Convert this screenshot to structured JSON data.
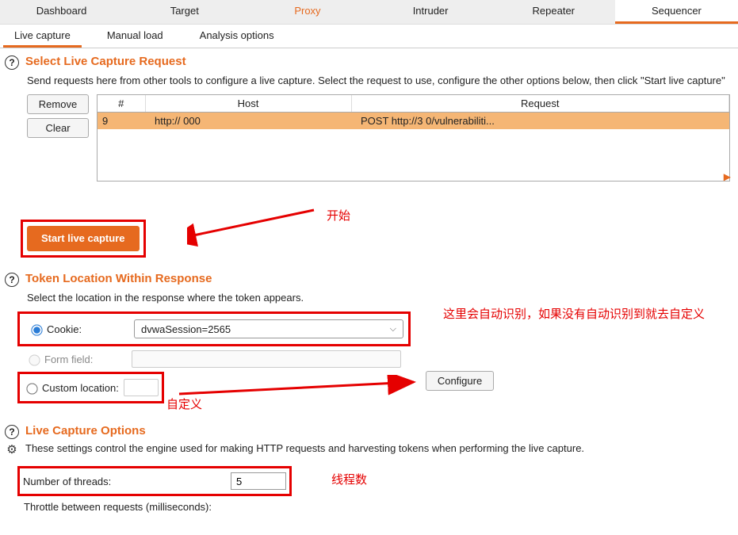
{
  "tool_tabs": {
    "dashboard": "Dashboard",
    "target": "Target",
    "proxy": "Proxy",
    "intruder": "Intruder",
    "repeater": "Repeater",
    "sequencer": "Sequencer"
  },
  "sub_tabs": {
    "live_capture": "Live capture",
    "manual_load": "Manual load",
    "analysis_options": "Analysis options"
  },
  "section1": {
    "title": "Select Live Capture Request",
    "desc": "Send requests here from other tools to configure a live capture. Select the request to use, configure the other options below, then click \"Start live capture\"",
    "remove": "Remove",
    "clear": "Clear",
    "col_num": "#",
    "col_host": "Host",
    "col_req": "Request",
    "row_num": "9",
    "row_host": "http://                          000",
    "row_req": "POST http://3                         0/vulnerabiliti...",
    "start_btn": "Start live capture"
  },
  "anno": {
    "start": "开始",
    "auto_detect": "这里会自动识别，如果没有自动识别到就去自定义",
    "custom": "自定义",
    "threads": "线程数"
  },
  "section2": {
    "title": "Token Location Within Response",
    "desc": "Select the location in the response where the token appears.",
    "cookie_label": "Cookie:",
    "cookie_value": "dvwaSession=2565",
    "form_label": "Form field:",
    "custom_label": "Custom location:",
    "configure": "Configure"
  },
  "section3": {
    "title": "Live Capture Options",
    "desc": "These settings control the engine used for making HTTP requests and harvesting tokens when performing the live capture.",
    "threads_label": "Number of threads:",
    "threads_value": "5",
    "throttle_label": "Throttle between requests (milliseconds):"
  }
}
